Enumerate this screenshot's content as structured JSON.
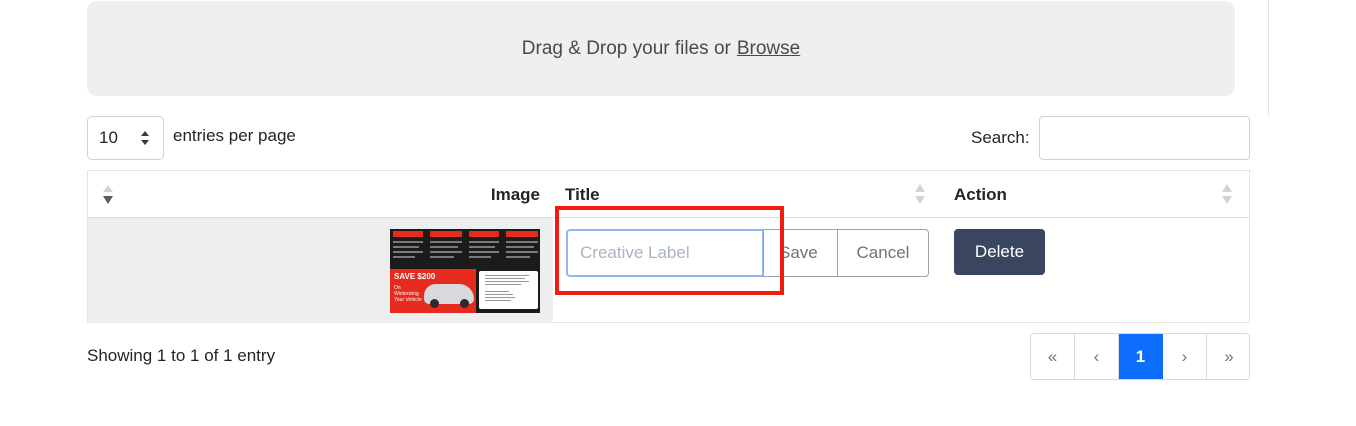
{
  "dropzone": {
    "text": "Drag & Drop your files or",
    "browse": "Browse"
  },
  "entries": {
    "value": "10",
    "label": "entries per page"
  },
  "search": {
    "label": "Search:",
    "value": ""
  },
  "table": {
    "headers": {
      "image": "Image",
      "title": "Title",
      "action": "Action"
    },
    "row": {
      "thumbnail": {
        "headline": "SAVE $200",
        "sub": "On Winterizing Your Vehicle"
      },
      "title_placeholder": "Creative Label",
      "save": "Save",
      "cancel": "Cancel",
      "delete": "Delete"
    }
  },
  "footer": {
    "showing": "Showing 1 to 1 of 1 entry"
  },
  "pagination": {
    "first": "«",
    "prev": "‹",
    "current": "1",
    "next": "›",
    "last": "»"
  },
  "colors": {
    "accent": "#0d6efd",
    "delete": "#3a4660",
    "highlight": "#f31a0f"
  }
}
